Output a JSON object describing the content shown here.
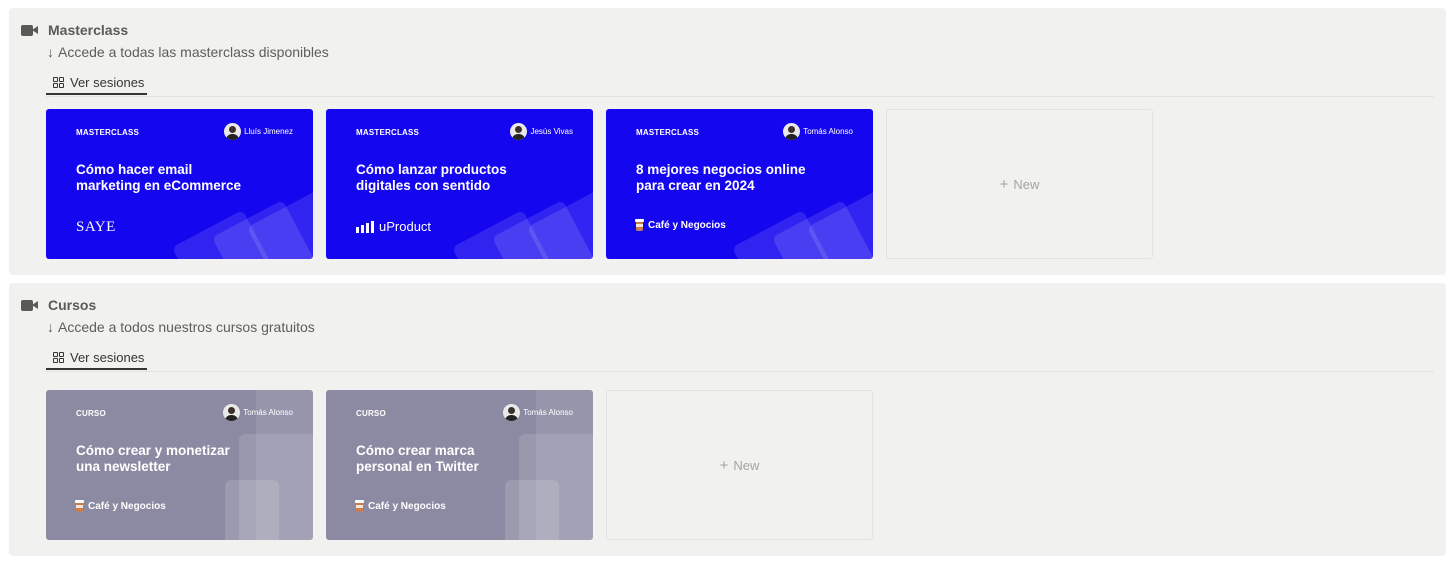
{
  "sections": [
    {
      "title": "Masterclass",
      "subtitle": "Accede a todas las masterclass disponibles",
      "view_tab": "Ver sesiones",
      "cards": [
        {
          "kicker": "MASTERCLASS",
          "author": "Lluís Jimenez",
          "title": "Cómo hacer email marketing en eCommerce",
          "brand": "SAYE"
        },
        {
          "kicker": "MASTERCLASS",
          "author": "Jesús Vivas",
          "title": "Cómo lanzar productos digitales con sentido",
          "brand": "uProduct"
        },
        {
          "kicker": "MASTERCLASS",
          "author": "Tomás Alonso",
          "title": "8 mejores negocios online para crear en 2024",
          "brand": "Café y Negocios"
        }
      ],
      "new_label": "New"
    },
    {
      "title": "Cursos",
      "subtitle": "Accede a todos nuestros cursos gratuitos",
      "view_tab": "Ver sesiones",
      "cards": [
        {
          "kicker": "CURSO",
          "author": "Tomás Alonso",
          "title": "Cómo crear y monetizar una newsletter",
          "brand": "Café y Negocios"
        },
        {
          "kicker": "CURSO",
          "author": "Tomás Alonso",
          "title": "Cómo crear marca personal en Twitter",
          "brand": "Café y Negocios"
        }
      ],
      "new_label": "New"
    }
  ],
  "icons": {
    "section": "video-camera-icon",
    "subtitle": "arrow-down-icon",
    "tab": "gallery-grid-icon",
    "new": "plus-icon",
    "brand_cafe": "coffee-cup-icon",
    "brand_uproduct": "bars-icon"
  },
  "colors": {
    "masterclass_card": "#1506f0",
    "curso_card": "#8b8aa2",
    "section_bg": "#f1f1ef"
  }
}
